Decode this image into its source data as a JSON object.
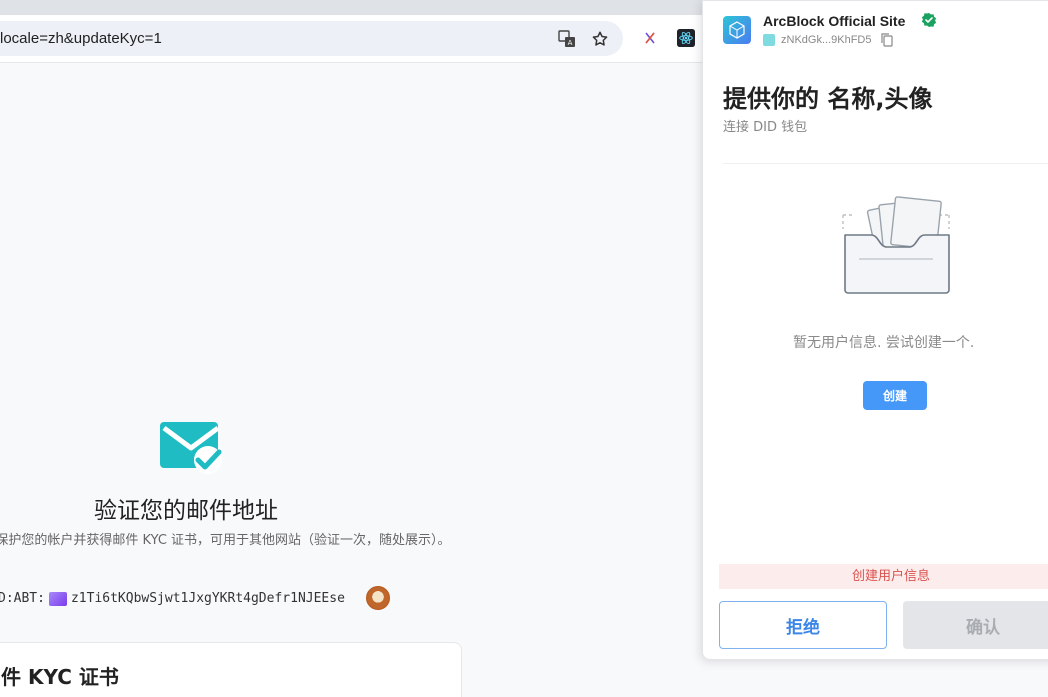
{
  "browser": {
    "url": "locale=zh&updateKyc=1"
  },
  "page": {
    "verify_title": "验证您的邮件地址",
    "verify_desc": "保护您的帐户并获得邮件 KYC 证书，可用于其他网站（验证一次，随处展示）。",
    "did_prefix": "D:ABT:",
    "did_value": "z1Ti6tKQbwSjwt1JxgYKRt4gDefr1NJEEse",
    "kyc_card_title": "件 KYC 证书"
  },
  "popup": {
    "site_name": "ArcBlock Official Site",
    "site_did": "zNKdGk...9KhFD5",
    "title": "提供你的 名称,头像",
    "subtitle": "连接 DID 钱包",
    "empty_text": "暂无用户信息. 尝试创建一个.",
    "create_label": "创建",
    "status_text": "创建用户信息",
    "reject_label": "拒绝",
    "confirm_label": "确认"
  },
  "colors": {
    "accent": "#4598f8",
    "teal": "#1fbcc4",
    "verified": "#1aa260",
    "error_bg": "#fdecec",
    "error_text": "#d9534f"
  }
}
